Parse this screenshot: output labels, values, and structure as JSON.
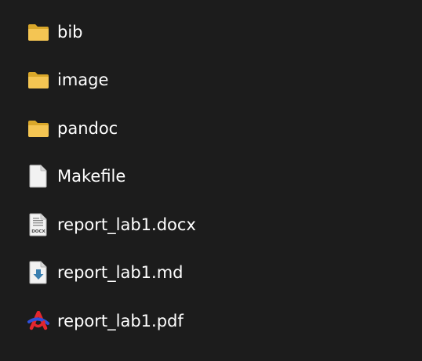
{
  "items": [
    {
      "name": "bib",
      "icon": "folder-icon"
    },
    {
      "name": "image",
      "icon": "folder-icon"
    },
    {
      "name": "pandoc",
      "icon": "folder-icon"
    },
    {
      "name": "Makefile",
      "icon": "blank-file-icon"
    },
    {
      "name": "report_lab1.docx",
      "icon": "docx-file-icon",
      "icon_label": "DOCX"
    },
    {
      "name": "report_lab1.md",
      "icon": "markdown-file-icon"
    },
    {
      "name": "report_lab1.pdf",
      "icon": "pdf-file-icon"
    }
  ],
  "colors": {
    "background": "#1c1c1c",
    "text": "#ffffff",
    "folder": "#f4c553",
    "folder_dark": "#d9a72a",
    "file": "#f2f2f2",
    "md_arrow": "#3a7fb0",
    "pdf_red": "#e3262e",
    "pdf_blue": "#2f4fd9"
  }
}
